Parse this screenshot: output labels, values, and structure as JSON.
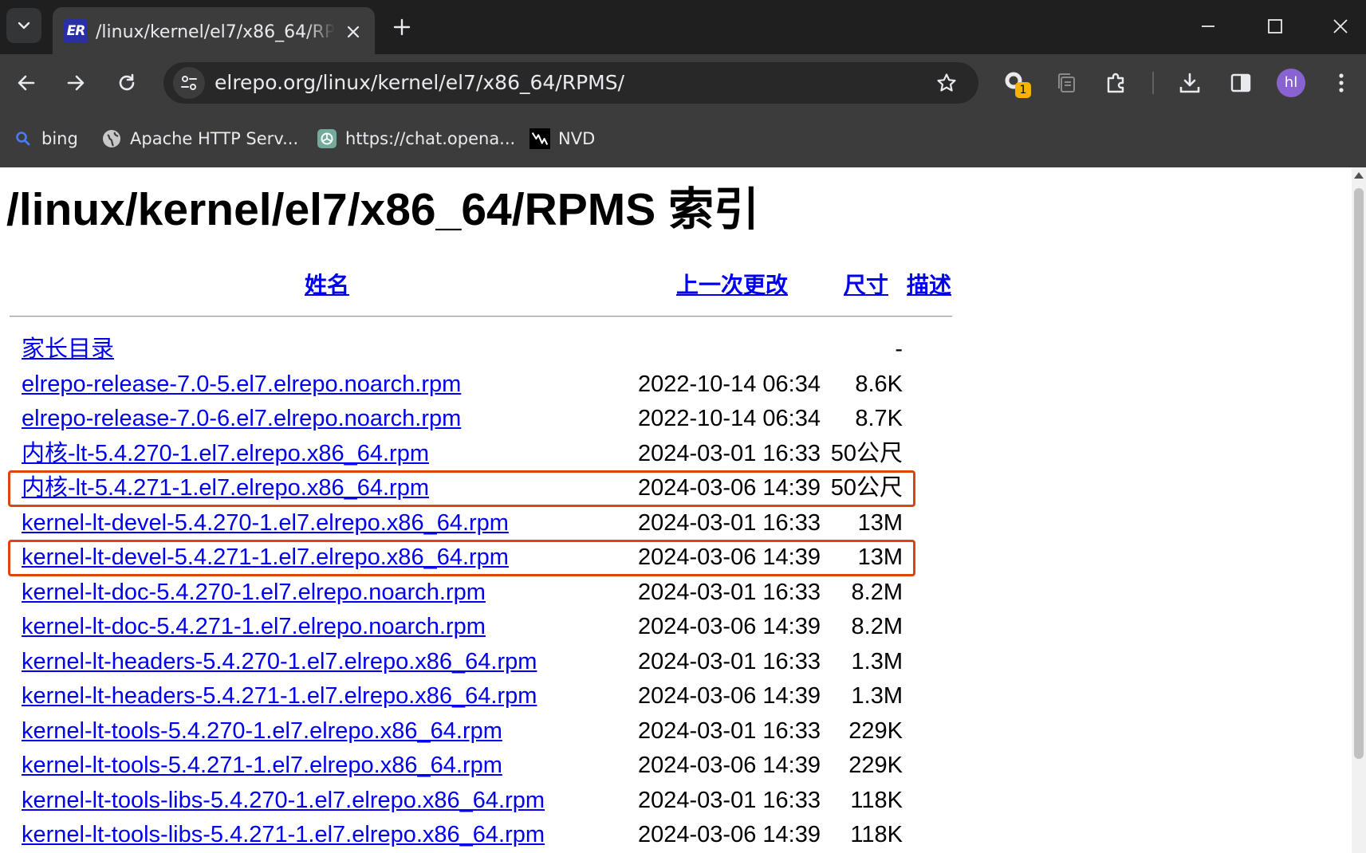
{
  "browser": {
    "tab": {
      "title": "/linux/kernel/el7/x86_64/RPMS/",
      "favicon_text": "ER"
    },
    "address_bar": {
      "url": "elrepo.org/linux/kernel/el7/x86_64/RPMS/"
    },
    "extension_badge": "1",
    "profile_initials": "hl",
    "bookmarks": [
      {
        "label": "bing",
        "icon": "search-icon"
      },
      {
        "label": "Apache HTTP Serv...",
        "icon": "globe-icon"
      },
      {
        "label": "https://chat.opena...",
        "icon": "chatgpt-icon"
      },
      {
        "label": "NVD",
        "icon": "nvd-icon"
      }
    ],
    "colors": {
      "tabstrip": "#1f1f1f",
      "toolbar": "#3c3c3c",
      "omnibox": "#282828",
      "avatar": "#8a63d2",
      "badge": "#f4b400"
    }
  },
  "page": {
    "title": "/linux/kernel/el7/x86_64/RPMS 索引",
    "columns": {
      "name": "姓名",
      "last_modified": "上一次更改",
      "size": "尺寸",
      "description": "描述"
    },
    "rows": [
      {
        "name": "家长目录",
        "date": "",
        "size": "-"
      },
      {
        "name": "elrepo-release-7.0-5.el7.elrepo.noarch.rpm",
        "date": "2022-10-14 06:34",
        "size": "8.6K"
      },
      {
        "name": "elrepo-release-7.0-6.el7.elrepo.noarch.rpm",
        "date": "2022-10-14 06:34",
        "size": "8.7K"
      },
      {
        "name": "内核-lt-5.4.270-1.el7.elrepo.x86_64.rpm",
        "date": "2024-03-01 16:33",
        "size": "50公尺"
      },
      {
        "name": "内核-lt-5.4.271-1.el7.elrepo.x86_64.rpm",
        "date": "2024-03-06 14:39",
        "size": "50公尺",
        "highlighted": true
      },
      {
        "name": "kernel-lt-devel-5.4.270-1.el7.elrepo.x86_64.rpm",
        "date": "2024-03-01 16:33",
        "size": "13M"
      },
      {
        "name": "kernel-lt-devel-5.4.271-1.el7.elrepo.x86_64.rpm",
        "date": "2024-03-06 14:39",
        "size": "13M",
        "highlighted": true
      },
      {
        "name": "kernel-lt-doc-5.4.270-1.el7.elrepo.noarch.rpm",
        "date": "2024-03-01 16:33",
        "size": "8.2M"
      },
      {
        "name": "kernel-lt-doc-5.4.271-1.el7.elrepo.noarch.rpm",
        "date": "2024-03-06 14:39",
        "size": "8.2M"
      },
      {
        "name": "kernel-lt-headers-5.4.270-1.el7.elrepo.x86_64.rpm",
        "date": "2024-03-01 16:33",
        "size": "1.3M"
      },
      {
        "name": "kernel-lt-headers-5.4.271-1.el7.elrepo.x86_64.rpm",
        "date": "2024-03-06 14:39",
        "size": "1.3M"
      },
      {
        "name": "kernel-lt-tools-5.4.270-1.el7.elrepo.x86_64.rpm",
        "date": "2024-03-01 16:33",
        "size": "229K"
      },
      {
        "name": "kernel-lt-tools-5.4.271-1.el7.elrepo.x86_64.rpm",
        "date": "2024-03-06 14:39",
        "size": "229K"
      },
      {
        "name": "kernel-lt-tools-libs-5.4.270-1.el7.elrepo.x86_64.rpm",
        "date": "2024-03-01 16:33",
        "size": "118K"
      },
      {
        "name": "kernel-lt-tools-libs-5.4.271-1.el7.elrepo.x86_64.rpm",
        "date": "2024-03-06 14:39",
        "size": "118K"
      }
    ],
    "highlight_color": "#e0440e",
    "link_color": "#0000ee"
  }
}
